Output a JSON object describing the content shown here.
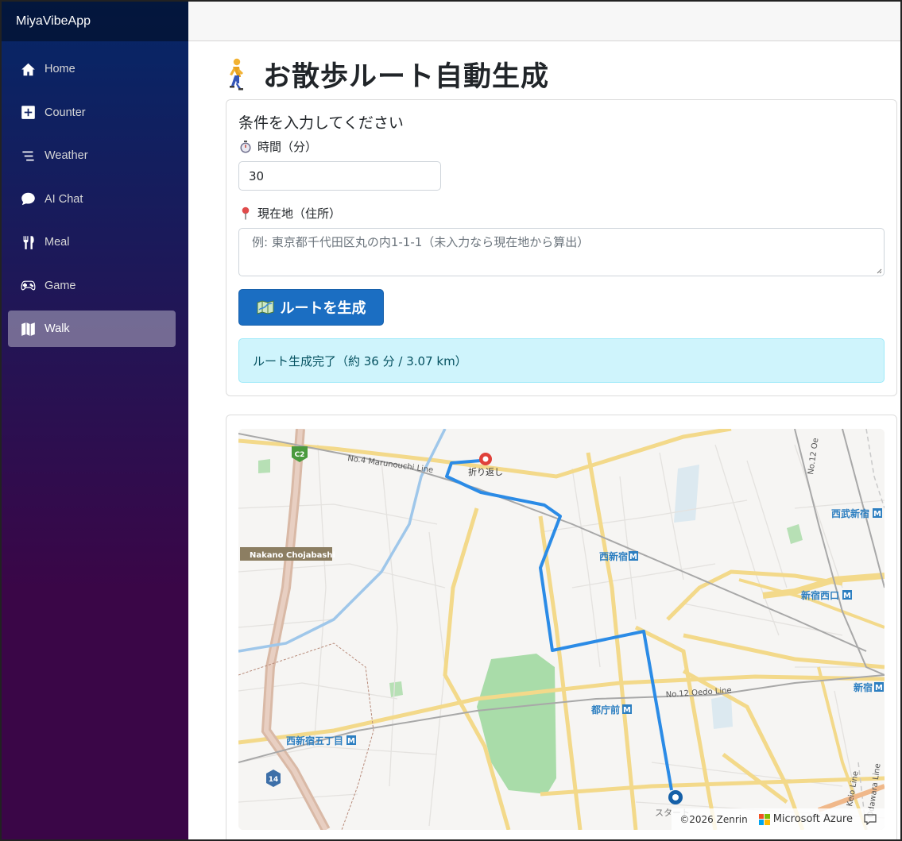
{
  "app": {
    "brand": "MiyaVibeApp"
  },
  "sidebar": {
    "items": [
      {
        "label": "Home",
        "icon": "home-icon"
      },
      {
        "label": "Counter",
        "icon": "plus-square-icon"
      },
      {
        "label": "Weather",
        "icon": "list-icon"
      },
      {
        "label": "AI Chat",
        "icon": "chat-bubble-icon"
      },
      {
        "label": "Meal",
        "icon": "fork-knife-icon"
      },
      {
        "label": "Game",
        "icon": "controller-icon"
      },
      {
        "label": "Walk",
        "icon": "map-icon",
        "active": true
      }
    ]
  },
  "page": {
    "title": "お散歩ルート自動生成",
    "title_icon": "walking-person-icon"
  },
  "form": {
    "heading": "条件を入力してください",
    "time_label": "時間（分）",
    "time_icon": "stopwatch-icon",
    "time_value": "30",
    "location_label": "現在地（住所）",
    "location_icon": "pin-icon",
    "location_placeholder": "例: 東京都千代田区丸の内1-1-1（未入力なら現在地から算出）",
    "submit_label": "ルートを生成",
    "submit_icon": "map-icon"
  },
  "result": {
    "message": "ルート生成完了（約 36 分 / 3.07 km）"
  },
  "map": {
    "labels": {
      "marunouchi_line": "No.4 Marunouchi Line",
      "turnaround": "折り返し",
      "nakano_chojabashi": "Nakano Chojabashi",
      "nishi_shinjuku": "西新宿",
      "seibu_shinjuku": "西武新宿",
      "shinjuku_nishiguchi": "新宿西口",
      "shinjuku": "新宿",
      "oedo_line": "No.12 Oedo Line",
      "tochomae": "都庁前",
      "nishi_shinjuku_gochome": "西新宿五丁目",
      "start": "スタート",
      "c2_shield": "C2",
      "route14_shield": "14",
      "odawara_line": "Odawara Line",
      "keio_line": "Keio Line",
      "no12_oedo_side": "No.12 Oe"
    },
    "attribution": "©2026 Zenrin",
    "provider": "Microsoft Azure",
    "route_color": "#2b8be6",
    "turnaround_color": "#e0413a",
    "start_color": "#1560a8"
  }
}
